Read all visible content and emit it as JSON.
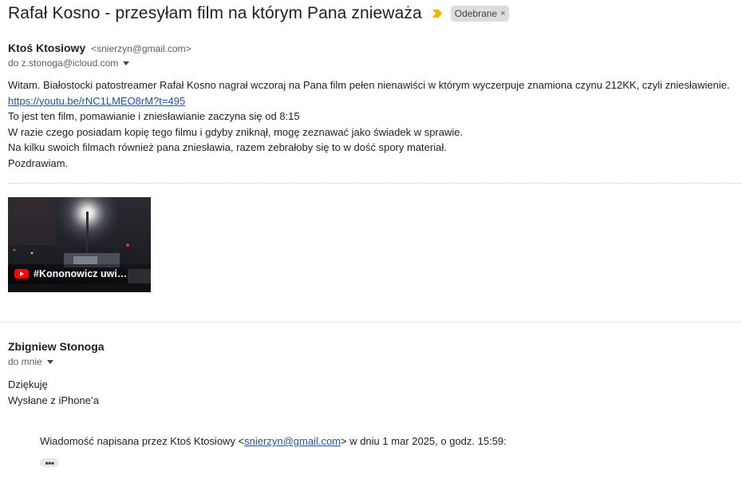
{
  "thread": {
    "subject": "Rafał Kosno - przesyłam film na którym Pana znieważa",
    "label": "Odebrane",
    "label_remove": "×",
    "importance_color": "#f4b400"
  },
  "message1": {
    "sender_name": "Ktoś Ktosiowy",
    "sender_email": "<snierzyn@gmail.com>",
    "recipient": "do z.stonoga@icloud.com",
    "body": {
      "line1": "Witam. Białostocki patostreamer Rafał Kosno nagrał wczoraj na Pana film pełen nienawiści w którym wyczerpuje znamiona czynu 212KK, czyli zniesławienie.",
      "link": "https://youtu.be/rNC1LMEO8rM?t=495",
      "line3": "To jest ten film, pomawianie i zniesławianie zaczyna się od 8:15",
      "line4": "W razie czego posiadam kopię tego filmu i gdyby zniknął, mogę zeznawać jako świadek w sprawie.",
      "line5": "Na kilku swoich filmach również pana zniesławia, razem zebrałoby się to w dość spory materiał.",
      "line6": "Pozdrawiam."
    },
    "video_preview": {
      "title": "#Kononowicz uwi…",
      "icon": "youtube-icon"
    }
  },
  "message2": {
    "sender_name": "Zbigniew Stonoga",
    "recipient": "do mnie",
    "body": {
      "line1": "Dziękuję",
      "line2": "Wysłane z iPhone’a"
    },
    "quote": {
      "prefix": "Wiadomość napisana przez Ktoś Ktosiowy <",
      "email": "snierzyn@gmail.com",
      "suffix": "> w dniu 1 mar 2025, o godz. 15:59:"
    },
    "show_trimmed_label": "•••"
  },
  "colors": {
    "link": "#1a56b0",
    "youtube_red": "#ff0000"
  }
}
